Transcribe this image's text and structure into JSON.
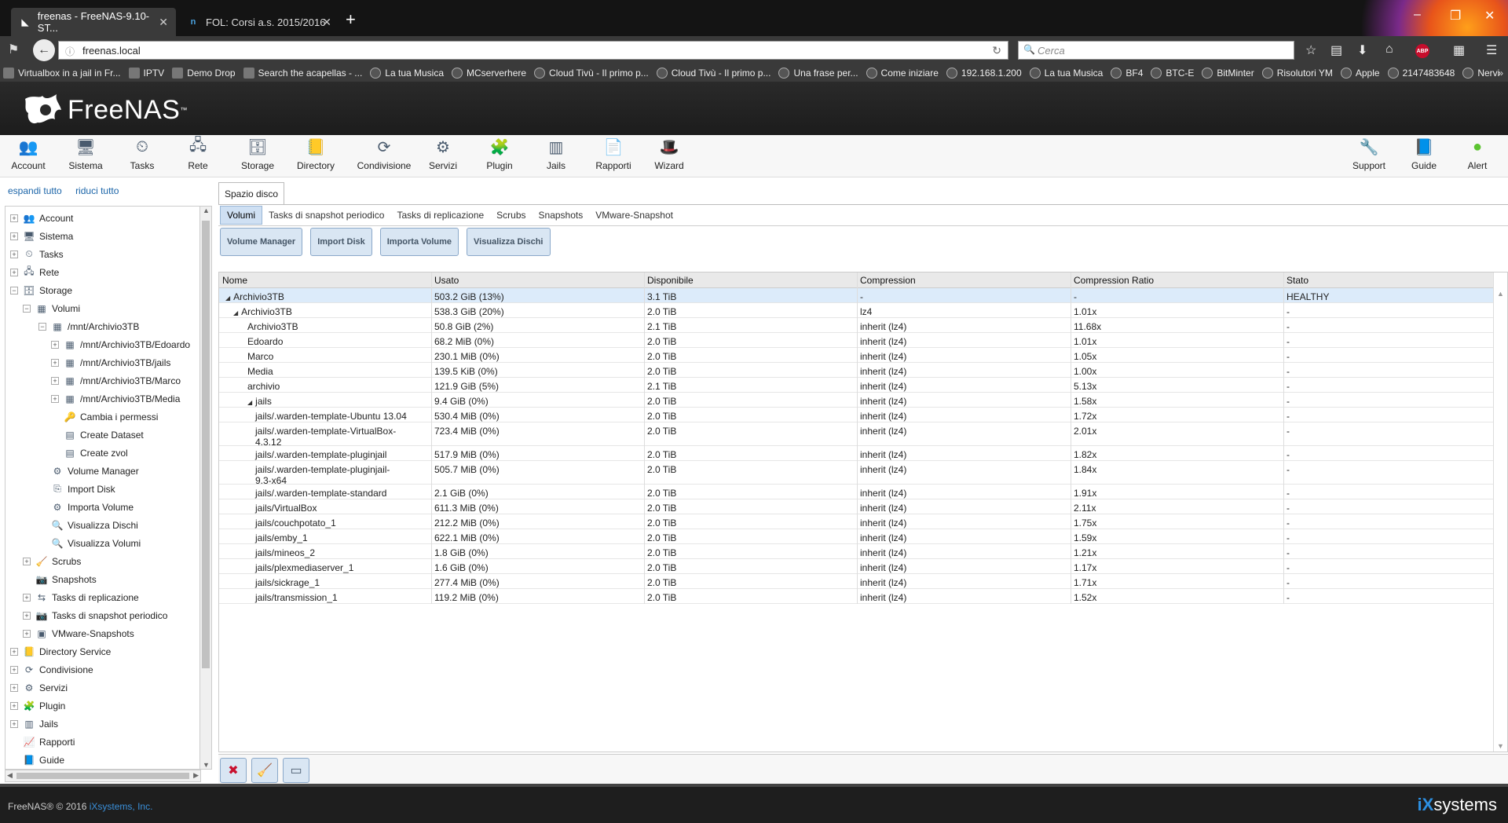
{
  "browser": {
    "tabs": [
      {
        "title": "freenas - FreeNAS-9.10-ST...",
        "active": true
      },
      {
        "title": "FOL: Corsi a.s. 2015/2016",
        "active": false
      }
    ],
    "url": "freenas.local",
    "search_placeholder": "Cerca",
    "bookmarks": [
      "Virtualbox in a jail in Fr...",
      "IPTV",
      "Demo Drop",
      "Search the acapellas - ...",
      "La tua Musica",
      "MCserverhere",
      "Cloud Tivù - Il primo p...",
      "Cloud Tivù - Il primo p...",
      "Una frase per...",
      "Come iniziare",
      "192.168.1.200",
      "La tua Musica",
      "BF4",
      "BTC-E",
      "BitMinter",
      "Risolutori YM",
      "Apple",
      "2147483648",
      "Nervi"
    ],
    "abp_label": "ABP"
  },
  "app": {
    "name": "FreeNAS",
    "trademark": "™"
  },
  "toolbar": {
    "left": [
      {
        "label": "Account",
        "icon": "account-icon",
        "glyph": "👥"
      },
      {
        "label": "Sistema",
        "icon": "system-icon",
        "glyph": "🖥"
      },
      {
        "label": "Tasks",
        "icon": "tasks-icon",
        "glyph": "⏲"
      },
      {
        "label": "Rete",
        "icon": "network-icon",
        "glyph": "🖧"
      },
      {
        "label": "Storage",
        "icon": "storage-icon",
        "glyph": "🗄"
      },
      {
        "label": "Directory",
        "icon": "directory-icon",
        "glyph": "📒"
      },
      {
        "label": "Condivisione",
        "icon": "sharing-icon",
        "glyph": "⟳"
      },
      {
        "label": "Servizi",
        "icon": "services-icon",
        "glyph": "⚙"
      },
      {
        "label": "Plugin",
        "icon": "plugin-icon",
        "glyph": "🧩"
      },
      {
        "label": "Jails",
        "icon": "jails-icon",
        "glyph": "▥"
      },
      {
        "label": "Rapporti",
        "icon": "reports-icon",
        "glyph": "📄"
      },
      {
        "label": "Wizard",
        "icon": "wizard-icon",
        "glyph": "🎩"
      }
    ],
    "right": [
      {
        "label": "Support",
        "icon": "support-icon",
        "glyph": "🔧"
      },
      {
        "label": "Guide",
        "icon": "guide-icon",
        "glyph": "📘"
      },
      {
        "label": "Alert",
        "icon": "alert-icon",
        "glyph": "●",
        "color": "#5cc431"
      }
    ]
  },
  "tree": {
    "expand_all": "espandi tutto",
    "collapse_all": "riduci tutto",
    "items": [
      {
        "label": "Account",
        "level": 0,
        "exp": "+",
        "icon": "account-icon",
        "glyph": "👥"
      },
      {
        "label": "Sistema",
        "level": 0,
        "exp": "+",
        "icon": "system-icon",
        "glyph": "🖥"
      },
      {
        "label": "Tasks",
        "level": 0,
        "exp": "+",
        "icon": "tasks-icon",
        "glyph": "⏲"
      },
      {
        "label": "Rete",
        "level": 0,
        "exp": "+",
        "icon": "network-icon",
        "glyph": "🖧"
      },
      {
        "label": "Storage",
        "level": 0,
        "exp": "−",
        "icon": "storage-icon",
        "glyph": "🗄"
      },
      {
        "label": "Volumi",
        "level": 1,
        "exp": "−",
        "icon": "volume-icon",
        "glyph": "▦"
      },
      {
        "label": "/mnt/Archivio3TB",
        "level": 2,
        "exp": "−",
        "icon": "volume-icon",
        "glyph": "▦"
      },
      {
        "label": "/mnt/Archivio3TB/Edoardo",
        "level": 3,
        "exp": "+",
        "icon": "dataset-icon",
        "glyph": "▦"
      },
      {
        "label": "/mnt/Archivio3TB/jails",
        "level": 3,
        "exp": "+",
        "icon": "dataset-icon",
        "glyph": "▦"
      },
      {
        "label": "/mnt/Archivio3TB/Marco",
        "level": 3,
        "exp": "+",
        "icon": "dataset-icon",
        "glyph": "▦"
      },
      {
        "label": "/mnt/Archivio3TB/Media",
        "level": 3,
        "exp": "+",
        "icon": "dataset-icon",
        "glyph": "▦"
      },
      {
        "label": "Cambia i permessi",
        "level": 3,
        "exp": "",
        "icon": "key-icon",
        "glyph": "🔑"
      },
      {
        "label": "Create Dataset",
        "level": 3,
        "exp": "",
        "icon": "create-dataset-icon",
        "glyph": "▤"
      },
      {
        "label": "Create zvol",
        "level": 3,
        "exp": "",
        "icon": "create-zvol-icon",
        "glyph": "▤"
      },
      {
        "label": "Volume Manager",
        "level": 2,
        "exp": "",
        "icon": "volume-manager-icon",
        "glyph": "⚙"
      },
      {
        "label": "Import Disk",
        "level": 2,
        "exp": "",
        "icon": "import-disk-icon",
        "glyph": "⎘"
      },
      {
        "label": "Importa Volume",
        "level": 2,
        "exp": "",
        "icon": "import-volume-icon",
        "glyph": "⚙"
      },
      {
        "label": "Visualizza Dischi",
        "level": 2,
        "exp": "",
        "icon": "view-disks-icon",
        "glyph": "🔍"
      },
      {
        "label": "Visualizza Volumi",
        "level": 2,
        "exp": "",
        "icon": "view-volumes-icon",
        "glyph": "🔍"
      },
      {
        "label": "Scrubs",
        "level": 1,
        "exp": "+",
        "icon": "scrubs-icon",
        "glyph": "🧹"
      },
      {
        "label": "Snapshots",
        "level": 1,
        "exp": "",
        "icon": "snapshots-icon",
        "glyph": "📷"
      },
      {
        "label": "Tasks di replicazione",
        "level": 1,
        "exp": "+",
        "icon": "replication-icon",
        "glyph": "⇆"
      },
      {
        "label": "Tasks di snapshot periodico",
        "level": 1,
        "exp": "+",
        "icon": "periodic-snapshot-icon",
        "glyph": "📷"
      },
      {
        "label": "VMware-Snapshots",
        "level": 1,
        "exp": "+",
        "icon": "vmware-icon",
        "glyph": "▣"
      },
      {
        "label": "Directory Service",
        "level": 0,
        "exp": "+",
        "icon": "directory-icon",
        "glyph": "📒"
      },
      {
        "label": "Condivisione",
        "level": 0,
        "exp": "+",
        "icon": "sharing-icon",
        "glyph": "⟳"
      },
      {
        "label": "Servizi",
        "level": 0,
        "exp": "+",
        "icon": "services-icon",
        "glyph": "⚙"
      },
      {
        "label": "Plugin",
        "level": 0,
        "exp": "+",
        "icon": "plugin-icon",
        "glyph": "🧩"
      },
      {
        "label": "Jails",
        "level": 0,
        "exp": "+",
        "icon": "jails-icon",
        "glyph": "▥"
      },
      {
        "label": "Rapporti",
        "level": 0,
        "exp": "",
        "icon": "reports-icon",
        "glyph": "📈"
      },
      {
        "label": "Guide",
        "level": 0,
        "exp": "",
        "icon": "guide-icon",
        "glyph": "📘"
      }
    ]
  },
  "main": {
    "outer_tab": "Spazio disco",
    "subtabs": [
      "Volumi",
      "Tasks di snapshot periodico",
      "Tasks di replicazione",
      "Scrubs",
      "Snapshots",
      "VMware-Snapshot"
    ],
    "buttons": [
      "Volume Manager",
      "Import Disk",
      "Importa Volume",
      "Visualizza Dischi"
    ],
    "columns": [
      "Nome",
      "Usato",
      "Disponibile",
      "Compression",
      "Compression Ratio",
      "Stato"
    ],
    "rows": [
      {
        "name": "Archivio3TB",
        "level": 0,
        "tri": "◢",
        "used": "503.2 GiB (13%)",
        "avail": "3.1 TiB",
        "comp": "-",
        "ratio": "-",
        "state": "HEALTHY",
        "selected": true
      },
      {
        "name": "Archivio3TB",
        "level": 1,
        "tri": "◢",
        "used": "538.3 GiB (20%)",
        "avail": "2.0 TiB",
        "comp": "lz4",
        "ratio": "1.01x",
        "state": "-"
      },
      {
        "name": "Archivio3TB",
        "level": 2,
        "tri": "",
        "used": "50.8 GiB (2%)",
        "avail": "2.1 TiB",
        "comp": "inherit (lz4)",
        "ratio": "11.68x",
        "state": "-"
      },
      {
        "name": "Edoardo",
        "level": 2,
        "tri": "",
        "used": "68.2 MiB (0%)",
        "avail": "2.0 TiB",
        "comp": "inherit (lz4)",
        "ratio": "1.01x",
        "state": "-"
      },
      {
        "name": "Marco",
        "level": 2,
        "tri": "",
        "used": "230.1 MiB (0%)",
        "avail": "2.0 TiB",
        "comp": "inherit (lz4)",
        "ratio": "1.05x",
        "state": "-"
      },
      {
        "name": "Media",
        "level": 2,
        "tri": "",
        "used": "139.5 KiB (0%)",
        "avail": "2.0 TiB",
        "comp": "inherit (lz4)",
        "ratio": "1.00x",
        "state": "-"
      },
      {
        "name": "archivio",
        "level": 2,
        "tri": "",
        "used": "121.9 GiB (5%)",
        "avail": "2.1 TiB",
        "comp": "inherit (lz4)",
        "ratio": "5.13x",
        "state": "-"
      },
      {
        "name": "jails",
        "level": 2,
        "tri": "◢",
        "used": "9.4 GiB (0%)",
        "avail": "2.0 TiB",
        "comp": "inherit (lz4)",
        "ratio": "1.58x",
        "state": "-"
      },
      {
        "name": "jails/.warden-template-Ubuntu 13.04",
        "level": 3,
        "tri": "",
        "used": "530.4 MiB (0%)",
        "avail": "2.0 TiB",
        "comp": "inherit (lz4)",
        "ratio": "1.72x",
        "state": "-"
      },
      {
        "name": "jails/.warden-template-VirtualBox-\n4.3.12",
        "level": 3,
        "tri": "",
        "used": "723.4 MiB (0%)",
        "avail": "2.0 TiB",
        "comp": "inherit (lz4)",
        "ratio": "2.01x",
        "state": "-",
        "tall": true
      },
      {
        "name": "jails/.warden-template-pluginjail",
        "level": 3,
        "tri": "",
        "used": "517.9 MiB (0%)",
        "avail": "2.0 TiB",
        "comp": "inherit (lz4)",
        "ratio": "1.82x",
        "state": "-"
      },
      {
        "name": "jails/.warden-template-pluginjail-\n9.3-x64",
        "level": 3,
        "tri": "",
        "used": "505.7 MiB (0%)",
        "avail": "2.0 TiB",
        "comp": "inherit (lz4)",
        "ratio": "1.84x",
        "state": "-",
        "tall": true
      },
      {
        "name": "jails/.warden-template-standard",
        "level": 3,
        "tri": "",
        "used": "2.1 GiB (0%)",
        "avail": "2.0 TiB",
        "comp": "inherit (lz4)",
        "ratio": "1.91x",
        "state": "-"
      },
      {
        "name": "jails/VirtualBox",
        "level": 3,
        "tri": "",
        "used": "611.3 MiB (0%)",
        "avail": "2.0 TiB",
        "comp": "inherit (lz4)",
        "ratio": "2.11x",
        "state": "-"
      },
      {
        "name": "jails/couchpotato_1",
        "level": 3,
        "tri": "",
        "used": "212.2 MiB (0%)",
        "avail": "2.0 TiB",
        "comp": "inherit (lz4)",
        "ratio": "1.75x",
        "state": "-"
      },
      {
        "name": "jails/emby_1",
        "level": 3,
        "tri": "",
        "used": "622.1 MiB (0%)",
        "avail": "2.0 TiB",
        "comp": "inherit (lz4)",
        "ratio": "1.59x",
        "state": "-"
      },
      {
        "name": "jails/mineos_2",
        "level": 3,
        "tri": "",
        "used": "1.8 GiB (0%)",
        "avail": "2.0 TiB",
        "comp": "inherit (lz4)",
        "ratio": "1.21x",
        "state": "-"
      },
      {
        "name": "jails/plexmediaserver_1",
        "level": 3,
        "tri": "",
        "used": "1.6 GiB (0%)",
        "avail": "2.0 TiB",
        "comp": "inherit (lz4)",
        "ratio": "1.17x",
        "state": "-"
      },
      {
        "name": "jails/sickrage_1",
        "level": 3,
        "tri": "",
        "used": "277.4 MiB (0%)",
        "avail": "2.0 TiB",
        "comp": "inherit (lz4)",
        "ratio": "1.71x",
        "state": "-"
      },
      {
        "name": "jails/transmission_1",
        "level": 3,
        "tri": "",
        "used": "119.2 MiB (0%)",
        "avail": "2.0 TiB",
        "comp": "inherit (lz4)",
        "ratio": "1.52x",
        "state": "-"
      }
    ],
    "bottom_buttons": [
      {
        "icon": "detach-volume-icon",
        "glyph": "✖"
      },
      {
        "icon": "scrub-volume-icon",
        "glyph": "🧹"
      },
      {
        "icon": "volume-status-icon",
        "glyph": "▭"
      }
    ]
  },
  "footer": {
    "copyright": "FreeNAS® © 2016",
    "company": "iXsystems, Inc.",
    "brand_prefix": "iX",
    "brand_suffix": "systems"
  },
  "colors": {
    "selected_row": "#dcebfa",
    "button_bg": "#d9e6f3",
    "link": "#1a64a8",
    "alert_green": "#5cc431"
  }
}
